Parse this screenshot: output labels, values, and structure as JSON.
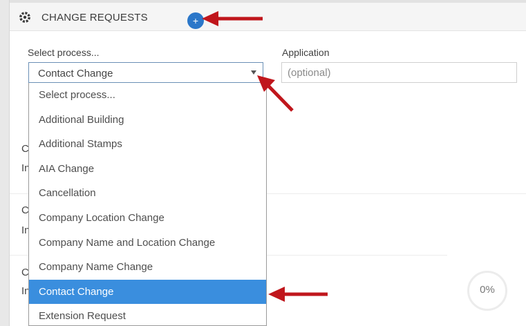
{
  "header": {
    "title": "CHANGE REQUESTS",
    "icon": "cog-icon",
    "add_button_label": "+"
  },
  "form": {
    "process_label": "Select process...",
    "process_value": "Contact Change",
    "application_label": "Application",
    "application_placeholder": "(optional)"
  },
  "dropdown": {
    "options": [
      "Select process...",
      "Additional Building",
      "Additional Stamps",
      "AIA Change",
      "Cancellation",
      "Company Location Change",
      "Company Name and Location Change",
      "Company Name Change",
      "Contact Change",
      "Extension Request"
    ],
    "selected": "Contact Change"
  },
  "background_rows": [
    {
      "line1": "C",
      "line2": "In"
    },
    {
      "line1": "C",
      "line2": "In"
    },
    {
      "line1": "C",
      "line2": "In"
    }
  ],
  "progress": {
    "text": "0%",
    "value": 0
  },
  "colors": {
    "accent": "#2b77c9",
    "selected_row": "#3a8ede",
    "arrow": "#c0161c"
  }
}
